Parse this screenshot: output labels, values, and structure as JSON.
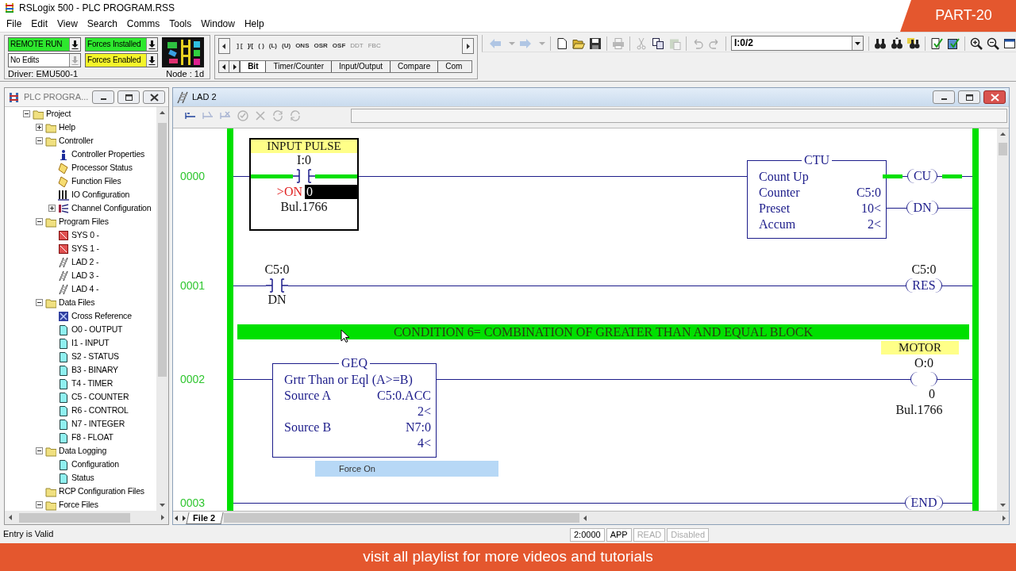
{
  "window": {
    "title": "RSLogix 500 - PLC PROGRAM.RSS"
  },
  "overlay": {
    "badge": "PART-20",
    "banner": "visit all  playlist for more videos and tutorials"
  },
  "menu": [
    "File",
    "Edit",
    "View",
    "Search",
    "Comms",
    "Tools",
    "Window",
    "Help"
  ],
  "controller_status": {
    "fields": [
      {
        "text": "REMOTE RUN",
        "color": "#2ee82e",
        "dropdown_disabled": false
      },
      {
        "text": "Forces Installed",
        "color": "#2ee82e",
        "dropdown_disabled": false
      },
      {
        "text": "No Edits",
        "color": "#ffffff",
        "dropdown_disabled": true
      },
      {
        "text": "Forces Enabled",
        "color": "#f5f52a",
        "dropdown_disabled": false
      }
    ],
    "driver": "Driver: EMU500-1",
    "node": "Node :  1d"
  },
  "instruction_palette": {
    "instructions": [
      {
        "label": "] [",
        "disabled": false
      },
      {
        "label": "]/[",
        "disabled": false
      },
      {
        "label": "( )",
        "disabled": false
      },
      {
        "label": "(L)",
        "disabled": false
      },
      {
        "label": "(U)",
        "disabled": false
      },
      {
        "label": "ONS",
        "disabled": false
      },
      {
        "label": "OSR",
        "disabled": false
      },
      {
        "label": "OSF",
        "disabled": false
      },
      {
        "label": "DDT",
        "disabled": true
      },
      {
        "label": "FBC",
        "disabled": true
      }
    ],
    "tabs": [
      {
        "label": "Bit",
        "selected": true
      },
      {
        "label": "Timer/Counter",
        "selected": false
      },
      {
        "label": "Input/Output",
        "selected": false
      },
      {
        "label": "Compare",
        "selected": false
      },
      {
        "label": "Com",
        "selected": false
      }
    ]
  },
  "toolbar": {
    "groups_before": [
      [
        {
          "kind": "back",
          "disabled": true
        },
        {
          "kind": "caret",
          "disabled": true
        },
        {
          "kind": "forward",
          "disabled": true
        },
        {
          "kind": "caret",
          "disabled": true
        }
      ],
      [
        {
          "kind": "new",
          "disabled": false
        },
        {
          "kind": "open",
          "disabled": false
        },
        {
          "kind": "save",
          "disabled": false
        }
      ],
      [
        {
          "kind": "print",
          "disabled": true
        }
      ],
      [
        {
          "kind": "cut",
          "disabled": true
        },
        {
          "kind": "copy",
          "disabled": false
        },
        {
          "kind": "paste",
          "disabled": true
        }
      ],
      [
        {
          "kind": "undo",
          "disabled": true
        },
        {
          "kind": "redo",
          "disabled": true
        }
      ]
    ],
    "address": "I:0/2",
    "groups_after": [
      [
        {
          "kind": "find",
          "disabled": false
        },
        {
          "kind": "find_next",
          "disabled": false
        },
        {
          "kind": "cross_reference",
          "disabled": false
        }
      ],
      [
        {
          "kind": "verify",
          "disabled": false
        },
        {
          "kind": "verify_all",
          "disabled": false
        }
      ],
      [
        {
          "kind": "zoom_in",
          "disabled": false
        },
        {
          "kind": "zoom_out",
          "disabled": false
        },
        {
          "kind": "window",
          "disabled": false
        }
      ]
    ]
  },
  "project_tree": {
    "title": "PLC PROGRA...",
    "items": [
      {
        "label": "Project",
        "kind": "folder",
        "expanded": true,
        "children": [
          {
            "label": "Help",
            "kind": "folder",
            "expanded": false
          },
          {
            "label": "Controller",
            "kind": "folder",
            "expanded": true,
            "children": [
              {
                "label": "Controller Properties",
                "kind": "info"
              },
              {
                "label": "Processor Status",
                "kind": "note"
              },
              {
                "label": "Function Files",
                "kind": "note"
              },
              {
                "label": "IO Configuration",
                "kind": "rack"
              },
              {
                "label": "Channel Configuration",
                "kind": "channel",
                "expanded": false
              }
            ]
          },
          {
            "label": "Program Files",
            "kind": "folder",
            "expanded": true,
            "children": [
              {
                "label": "SYS 0 -",
                "kind": "sys"
              },
              {
                "label": "SYS 1 -",
                "kind": "sys"
              },
              {
                "label": "LAD 2 -",
                "kind": "lad"
              },
              {
                "label": "LAD 3 -",
                "kind": "lad"
              },
              {
                "label": "LAD 4 -",
                "kind": "lad"
              }
            ]
          },
          {
            "label": "Data Files",
            "kind": "folder",
            "expanded": true,
            "children": [
              {
                "label": "Cross Reference",
                "kind": "xref"
              },
              {
                "label": "O0 - OUTPUT",
                "kind": "file"
              },
              {
                "label": "I1 - INPUT",
                "kind": "file"
              },
              {
                "label": "S2 - STATUS",
                "kind": "file"
              },
              {
                "label": "B3 - BINARY",
                "kind": "file"
              },
              {
                "label": "T4 - TIMER",
                "kind": "file"
              },
              {
                "label": "C5 - COUNTER",
                "kind": "file"
              },
              {
                "label": "R6 - CONTROL",
                "kind": "file"
              },
              {
                "label": "N7 - INTEGER",
                "kind": "file"
              },
              {
                "label": "F8 - FLOAT",
                "kind": "file"
              }
            ]
          },
          {
            "label": "Data Logging",
            "kind": "folder",
            "expanded": true,
            "children": [
              {
                "label": "Configuration",
                "kind": "file"
              },
              {
                "label": "Status",
                "kind": "file"
              }
            ]
          },
          {
            "label": "RCP Configuration Files",
            "kind": "folder"
          },
          {
            "label": "Force Files",
            "kind": "folder",
            "expanded": true
          }
        ]
      }
    ]
  },
  "ladder": {
    "title": "LAD 2",
    "toolbar": [
      {
        "kind": "rung",
        "disabled": false
      },
      {
        "kind": "rung_edit",
        "disabled": true
      },
      {
        "kind": "rung_cancel",
        "disabled": true
      },
      {
        "kind": "accept",
        "disabled": true
      },
      {
        "kind": "delete",
        "disabled": true
      },
      {
        "kind": "test",
        "disabled": true
      },
      {
        "kind": "untest",
        "disabled": true
      }
    ],
    "rungs": [
      {
        "number": "0000",
        "instructions": [
          {
            "kind": "contact",
            "comment": "INPUT PULSE",
            "address": "I:0",
            "force": ">ON",
            "value": "0",
            "value_selected": true,
            "description": "Bul.1766",
            "energized": true
          },
          {
            "kind": "box",
            "title": "CTU",
            "rows": [
              {
                "label": "Count Up"
              },
              {
                "label": "Counter",
                "value": "C5:0"
              },
              {
                "label": "Preset",
                "value": "10<"
              },
              {
                "label": "Accum",
                "value": "2<"
              }
            ],
            "outputs": [
              {
                "label": "CU",
                "energized": true
              },
              {
                "label": "DN",
                "energized": false
              }
            ]
          }
        ]
      },
      {
        "number": "0001",
        "instructions": [
          {
            "kind": "contact",
            "address": "C5:0",
            "bit": "DN",
            "energized": false
          },
          {
            "kind": "coil",
            "address": "C5:0",
            "label": "RES",
            "energized": false
          }
        ]
      },
      {
        "number": "0002",
        "comment": "CONDITION 6= COMBINATION OF GREATER THAN AND EQUAL BLOCK",
        "instructions": [
          {
            "kind": "box",
            "title": "GEQ",
            "rows": [
              {
                "label": "Grtr Than or Eql (A>=B)"
              },
              {
                "label": "Source A",
                "value": "C5:0.ACC"
              },
              {
                "value": "2<"
              },
              {
                "label": "Source B",
                "value": "N7:0"
              },
              {
                "value": "4<"
              }
            ]
          },
          {
            "kind": "coil",
            "comment": "MOTOR",
            "address": "O:0",
            "value": "0",
            "description": "Bul.1766",
            "energized": false
          }
        ]
      },
      {
        "number": "0003",
        "instructions": [
          {
            "kind": "coil",
            "label": "END",
            "energized": false
          }
        ]
      }
    ],
    "tooltip": "Force On",
    "sheet_tab": "File 2"
  },
  "status_bar": {
    "message": "Entry is Valid",
    "fields": [
      {
        "text": "2:0000",
        "disabled": false
      },
      {
        "text": "APP",
        "disabled": false
      },
      {
        "text": "READ",
        "disabled": true
      },
      {
        "text": "Disabled",
        "disabled": true
      }
    ]
  }
}
